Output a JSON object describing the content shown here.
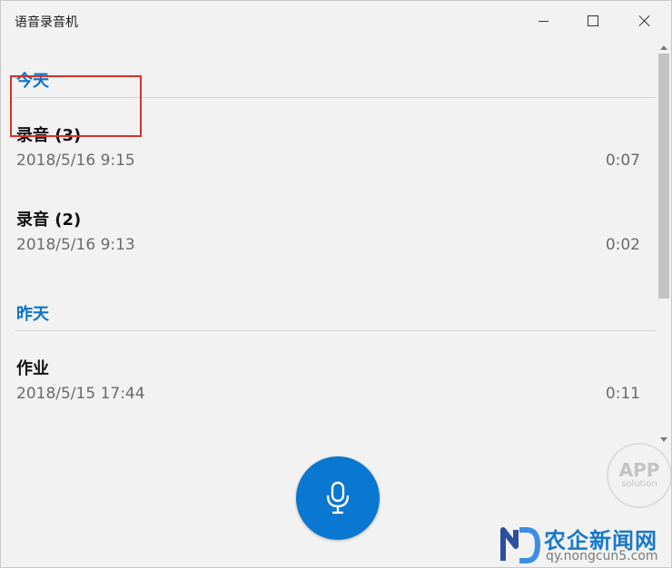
{
  "app": {
    "title": "语音录音机"
  },
  "titlebar": {
    "icons": [
      "minimize-icon",
      "maximize-icon",
      "close-icon"
    ]
  },
  "groups": [
    {
      "header": "今天",
      "recordings": [
        {
          "name": "录音 (3)",
          "date": "2018/5/16 9:15",
          "duration": "0:07",
          "highlighted": true
        },
        {
          "name": "录音 (2)",
          "date": "2018/5/16 9:13",
          "duration": "0:02",
          "highlighted": false
        }
      ]
    },
    {
      "header": "昨天",
      "recordings": [
        {
          "name": "作业",
          "date": "2018/5/15 17:44",
          "duration": "0:11",
          "highlighted": false
        }
      ]
    }
  ],
  "record_button": {
    "icon": "microphone-icon"
  },
  "watermark": {
    "app_big": "APP",
    "app_small": "solution",
    "site_name": "农企新闻网",
    "site_url": "qy.nongcun5.com"
  },
  "colors": {
    "accent": "#0a73c9",
    "mic_button": "#0a77d1",
    "highlight_border": "#d8312a",
    "background": "#f2f2f2"
  }
}
